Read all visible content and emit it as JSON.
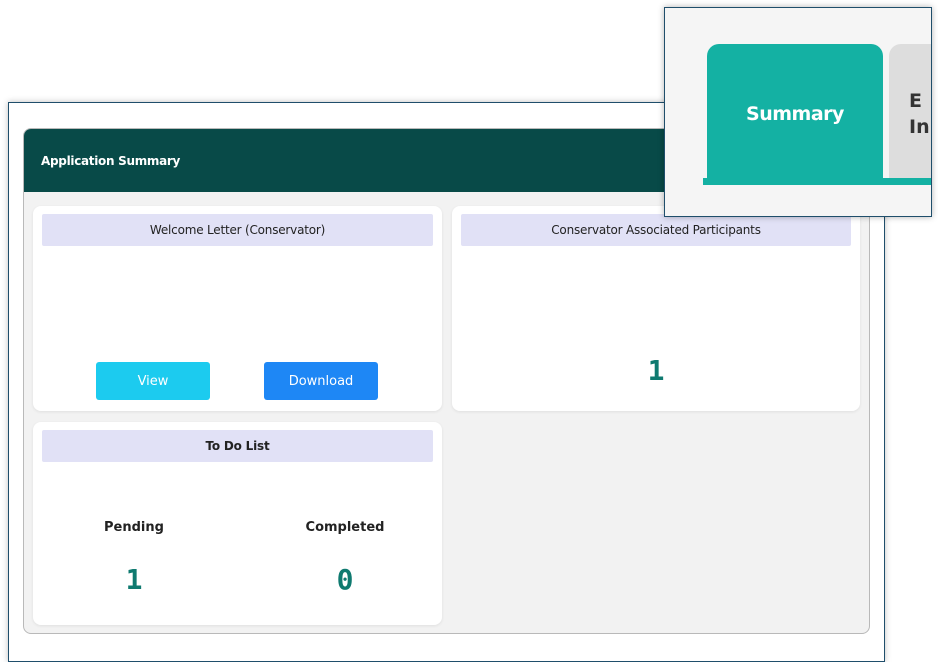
{
  "summary": {
    "header_title": "Application Summary"
  },
  "welcome_card": {
    "title": "Welcome Letter (Conservator)",
    "view_label": "View",
    "download_label": "Download"
  },
  "participants_card": {
    "title": "Conservator Associated Participants",
    "count": "1"
  },
  "todo_card": {
    "title": "To Do List",
    "pending_label": "Pending",
    "pending_count": "1",
    "completed_label": "Completed",
    "completed_count": "0"
  },
  "inset": {
    "active_tab_label": "Summary",
    "next_tab_partial": "E\nIn"
  },
  "colors": {
    "header_bg": "#084a48",
    "tab_active": "#14b1a3",
    "view_button": "#1ccbef",
    "download_button": "#1e87f5",
    "count_text": "#0f7a70",
    "card_title_bg": "#e1e1f6"
  }
}
